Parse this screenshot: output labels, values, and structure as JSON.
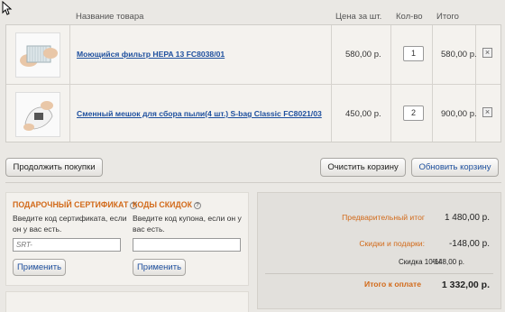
{
  "table": {
    "headers": {
      "name": "Название товара",
      "price": "Цена за шт.",
      "qty": "Кол-во",
      "total": "Итого"
    },
    "rows": [
      {
        "name": "Моющийся фильтр HEPA 13 FC8038/01",
        "price": "580,00 р.",
        "qty": "1",
        "total": "580,00 р."
      },
      {
        "name": "Сменный мешок для сбора пыли(4 шт.) S-bag Classic FC8021/03",
        "price": "450,00 р.",
        "qty": "2",
        "total": "900,00 р."
      }
    ],
    "delete_symbol": "×"
  },
  "actions": {
    "continue": "Продолжить покупки",
    "clear": "Очистить корзину",
    "update": "Обновить корзину"
  },
  "certificate": {
    "title": "ПОДАРОЧНЫЙ СЕРТИФИКАТ",
    "desc": "Введите код сертификата, если он у вас есть.",
    "placeholder": "SRT-",
    "apply": "Применить"
  },
  "coupon": {
    "title": "КОДЫ СКИДОК",
    "desc": "Введите код купона, если он у вас есть.",
    "placeholder": "",
    "apply": "Применить"
  },
  "summary": {
    "subtotal_label": "Предварительный итог",
    "subtotal_value": "1 480,00 р.",
    "discount_label": "Скидки и подарки:",
    "discount_value": "-148,00 р.",
    "detail_label": "Скидка 10%!",
    "detail_value": "-148,00 р.",
    "total_label": "Итого к оплате",
    "total_value": "1 332,00 р."
  },
  "colors": {
    "accent": "#d26a1a",
    "link": "#1d4f9e",
    "background": "#eae8e4"
  }
}
